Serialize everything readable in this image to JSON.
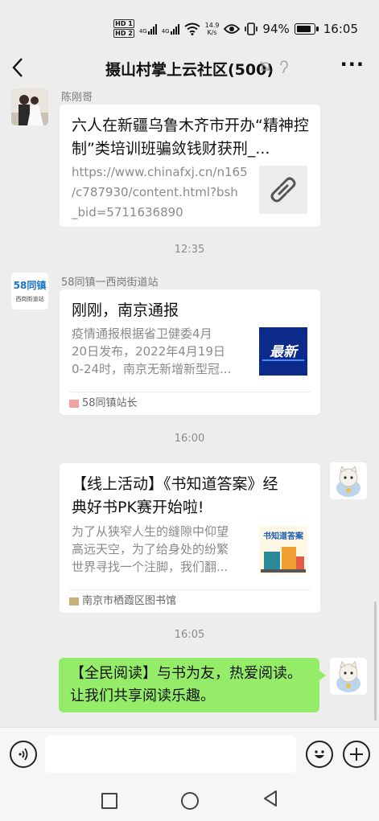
{
  "status": {
    "hd1": "HD 1",
    "hd2": "HD 2",
    "net": "4G",
    "speed_value": "14.9",
    "speed_unit": "K/s",
    "battery": "94%",
    "time": "16:05"
  },
  "header": {
    "title": "摄山村掌上云社区(500)",
    "back_icon": "chevron-left-icon",
    "mute_icon": "bell-off-icon",
    "more_label": "···"
  },
  "messages": {
    "m1": {
      "sender": "陈刚哥",
      "title": "六人在新疆乌鲁木齐市开办“精神控制”类培训班骗敛钱财获刑_...",
      "link_lines": [
        "https://www.chinafxj.cn/n165",
        "/c787930/content.html?bsh",
        "_bid=5711636890"
      ]
    },
    "time1": "12:35",
    "m2": {
      "sender": "58同镇一西岗街道站",
      "avatar_line1": "58同镇",
      "avatar_line2": "西岗街道站",
      "title": "刚刚，南京通报",
      "desc": [
        "疫情通报根据省卫健委4月",
        "20日发布，2022年4月19日",
        "0-24时，南京无新增新型冠..."
      ],
      "thumb_text": "最新",
      "footer": "58同镇站长"
    },
    "time2": "16:00",
    "m3": {
      "title_lines": [
        "【线上活动】《书知道答案》经",
        "典好书PK赛开始啦!"
      ],
      "desc": [
        "为了从狭窄人生的缝隙中仰望",
        "高远天空，为了给身处的纷繁",
        "世界寻找一个注脚，我们翻..."
      ],
      "thumb_text": "书知道答案",
      "footer": "南京市栖霞区图书馆"
    },
    "time3": "16:05",
    "m4": {
      "lines": [
        "【全民阅读】与书为友，热爱阅读。",
        "让我们共享阅读乐趣。"
      ]
    }
  },
  "inputbar": {
    "voice_icon": "voice-icon",
    "emoji_icon": "emoji-icon",
    "plus_icon": "plus-icon",
    "input_value": ""
  },
  "colors": {
    "bubble": "#95ec69",
    "background": "#ededed",
    "card": "#ffffff"
  }
}
